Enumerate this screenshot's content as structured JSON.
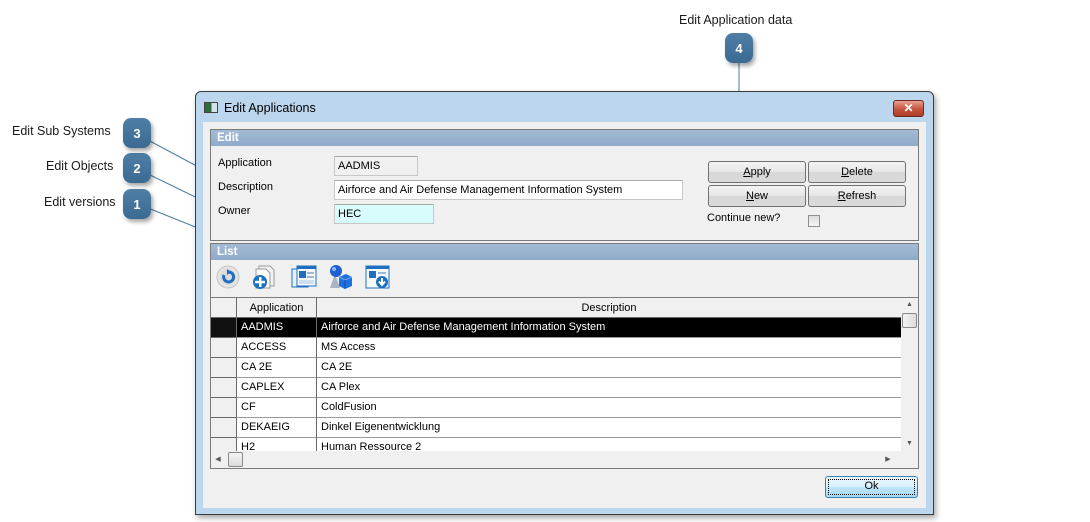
{
  "callouts": [
    {
      "number": "1",
      "label": "Edit versions"
    },
    {
      "number": "2",
      "label": "Edit Objects"
    },
    {
      "number": "3",
      "label": "Edit Sub Systems"
    },
    {
      "number": "4",
      "label": "Edit Application data"
    }
  ],
  "window": {
    "title": "Edit Applications",
    "close_icon": "close-icon"
  },
  "edit_group": {
    "header": "Edit",
    "application_label": "Application",
    "application_value": "AADMIS",
    "description_label": "Description",
    "description_value": "Airforce and Air Defense Management Information System",
    "owner_label": "Owner",
    "owner_value": "HEC",
    "buttons": {
      "apply": {
        "mnemonic": "A",
        "rest": "pply"
      },
      "delete": {
        "mnemonic": "D",
        "rest": "elete"
      },
      "new": {
        "mnemonic": "N",
        "rest": "ew"
      },
      "refresh": {
        "mnemonic": "R",
        "rest": "efresh"
      }
    },
    "continue_new_label": "Continue new?",
    "continue_new_checked": false
  },
  "list_group": {
    "header": "List",
    "toolbar": [
      {
        "icon": "refresh-icon"
      },
      {
        "icon": "add-new-icon"
      },
      {
        "icon": "edit-versions-icon"
      },
      {
        "icon": "edit-objects-icon"
      },
      {
        "icon": "edit-subsystems-icon"
      }
    ],
    "columns": [
      "Application",
      "Description"
    ],
    "rows": [
      {
        "application": "AADMIS",
        "description": "Airforce and Air Defense Management Information System",
        "selected": true
      },
      {
        "application": "ACCESS",
        "description": "MS Access"
      },
      {
        "application": "CA 2E",
        "description": "CA 2E"
      },
      {
        "application": "CAPLEX",
        "description": "CA Plex"
      },
      {
        "application": "CF",
        "description": "ColdFusion"
      },
      {
        "application": "DEKAEIG",
        "description": "Dinkel Eigenentwicklung"
      },
      {
        "application": "H2",
        "description": "Human Ressource 2"
      }
    ]
  },
  "footer": {
    "ok_label": "Ok"
  },
  "colors": {
    "callout_badge": "#3f6f97",
    "group_header": "#98b2cf",
    "selected_row": "#000000",
    "owner_field_bg": "#d8fcfc",
    "window_frame": "#bcd6ee"
  }
}
